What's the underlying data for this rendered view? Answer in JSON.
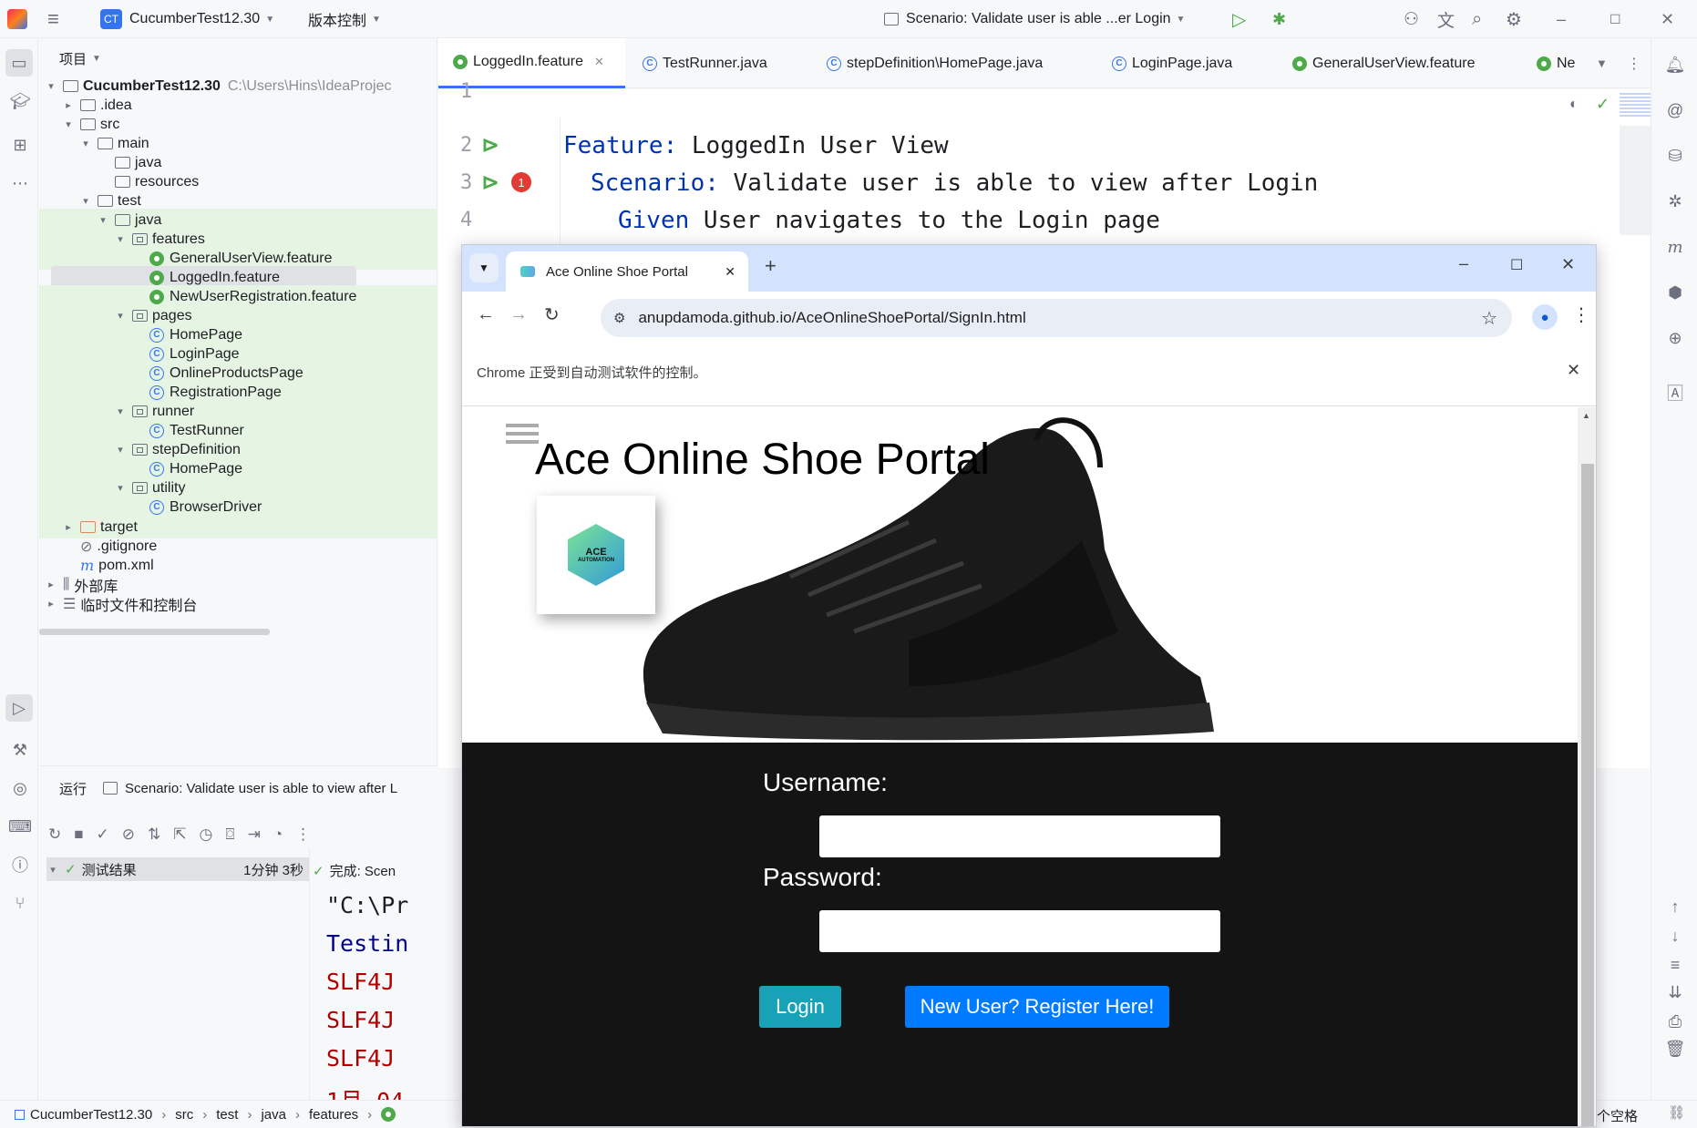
{
  "titlebar": {
    "project_badge": "CT",
    "project_name": "CucumberTest12.30",
    "vcs_label": "版本控制",
    "run_config": "Scenario: Validate user is able ...er Login"
  },
  "project_panel": {
    "title": "项目",
    "root_name": "CucumberTest12.30",
    "root_path": "C:\\Users\\Hins\\IdeaProjec",
    "items": [
      {
        "label": ".idea"
      },
      {
        "label": "src"
      },
      {
        "label": "main"
      },
      {
        "label": "java"
      },
      {
        "label": "resources"
      },
      {
        "label": "test"
      },
      {
        "label": "java"
      },
      {
        "label": "features"
      },
      {
        "label": "GeneralUserView.feature"
      },
      {
        "label": "LoggedIn.feature"
      },
      {
        "label": "NewUserRegistration.feature"
      },
      {
        "label": "pages"
      },
      {
        "label": "HomePage"
      },
      {
        "label": "LoginPage"
      },
      {
        "label": "OnlineProductsPage"
      },
      {
        "label": "RegistrationPage"
      },
      {
        "label": "runner"
      },
      {
        "label": "TestRunner"
      },
      {
        "label": "stepDefinition"
      },
      {
        "label": "HomePage"
      },
      {
        "label": "utility"
      },
      {
        "label": "BrowserDriver"
      },
      {
        "label": "target"
      },
      {
        "label": ".gitignore"
      },
      {
        "label": "pom.xml"
      },
      {
        "label": "外部库"
      },
      {
        "label": "临时文件和控制台"
      }
    ]
  },
  "editor": {
    "tabs": [
      {
        "label": "LoggedIn.feature"
      },
      {
        "label": "TestRunner.java"
      },
      {
        "label": "stepDefinition\\HomePage.java"
      },
      {
        "label": "LoginPage.java"
      },
      {
        "label": "GeneralUserView.feature"
      },
      {
        "label": "Ne"
      }
    ],
    "line_numbers": [
      "1",
      "2",
      "3",
      "4"
    ],
    "feature_kw": "Feature:",
    "feature_text": " LoggedIn User View",
    "scenario_kw": "Scenario:",
    "scenario_text": " Validate user is able to view after Login",
    "given_kw": "Given",
    "given_text": " User navigates to the Login page",
    "error_count": "1"
  },
  "run_panel": {
    "title": "运行",
    "run_tab": "Scenario: Validate user is able to view after L",
    "test_results": "测试结果",
    "duration": "1分钟 3秒",
    "done_text": "完成: Scen",
    "console_lines": [
      "\"C:\\Pr",
      "Testin",
      "SLF4J",
      "SLF4J",
      "SLF4J",
      "1月 04"
    ]
  },
  "statusbar": {
    "crumbs": [
      "CucumberTest12.30",
      "src",
      "test",
      "java",
      "features"
    ],
    "right_text": "个空格"
  },
  "chrome": {
    "tab_title": "Ace Online Shoe Portal",
    "url": "anupdamoda.github.io/AceOnlineShoePortal/SignIn.html",
    "info_text": "Chrome 正受到自动测试软件的控制。",
    "page": {
      "heading": "Ace Online Shoe Portal",
      "logo_text_1": "ACE",
      "logo_text_2": "AUTOMATION",
      "username_label": "Username:",
      "password_label": "Password:",
      "login_button": "Login",
      "register_button": "New User? Register Here!"
    }
  },
  "colors": {
    "accent": "#3574f0",
    "cucumber_green": "#4ea94b",
    "login_btn": "#17a2b8",
    "register_btn": "#007bff"
  }
}
